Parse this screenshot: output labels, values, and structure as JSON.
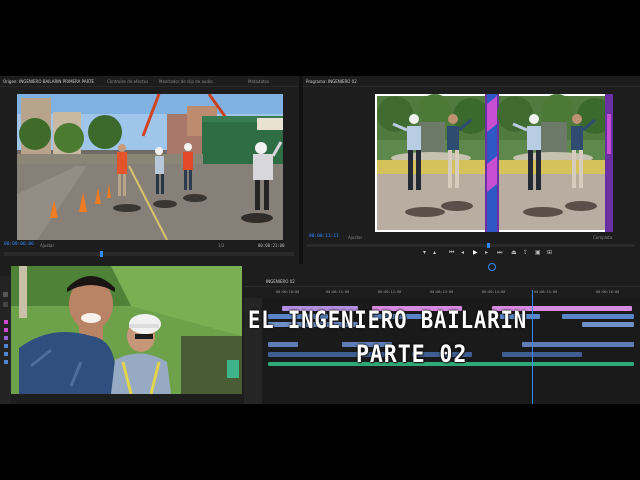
{
  "source_panel": {
    "tab_label": "Origen: INGENIERO BAILARIN PRIMERA PARTE",
    "other_tabs": [
      "Controles de efectos",
      "Mezclador de clip de audio",
      "Metadatos"
    ],
    "timecode_in": "00:09:06:06",
    "fit_label": "Ajustar",
    "fraction_label": "1/2",
    "timecode_out": "00:00:21:00"
  },
  "program_panel": {
    "tab_label": "Programa: INGENIERO 02",
    "timecode_in": "00:00:11:11",
    "fit_label": "Ajustar",
    "fraction_label": "Completa",
    "timecode_out": "00:00:21:15"
  },
  "timeline": {
    "sequence_tab": "INGENIERO 02",
    "ruler_labels": [
      "00:00:10:00",
      "00:00:11:00",
      "00:00:12:00",
      "00:00:13:00",
      "00:00:14:00",
      "00:00:15:00",
      "00:00:16:00"
    ]
  },
  "overlay": {
    "title_line1": "EL INGENIERO BAILARIN",
    "title_line2": "PARTE 02"
  },
  "colors": {
    "accent_blue": "#2f8cff",
    "clip_purple": "#8e7ad8",
    "clip_pink": "#d889e0",
    "clip_blue": "#5a86c8",
    "clip_green": "#2fa87a",
    "playhead": "#3c86ff"
  },
  "icons": [
    "play-icon",
    "step-back-icon",
    "step-forward-icon",
    "mark-in-icon",
    "mark-out-icon",
    "export-frame-icon",
    "wrench-icon"
  ]
}
